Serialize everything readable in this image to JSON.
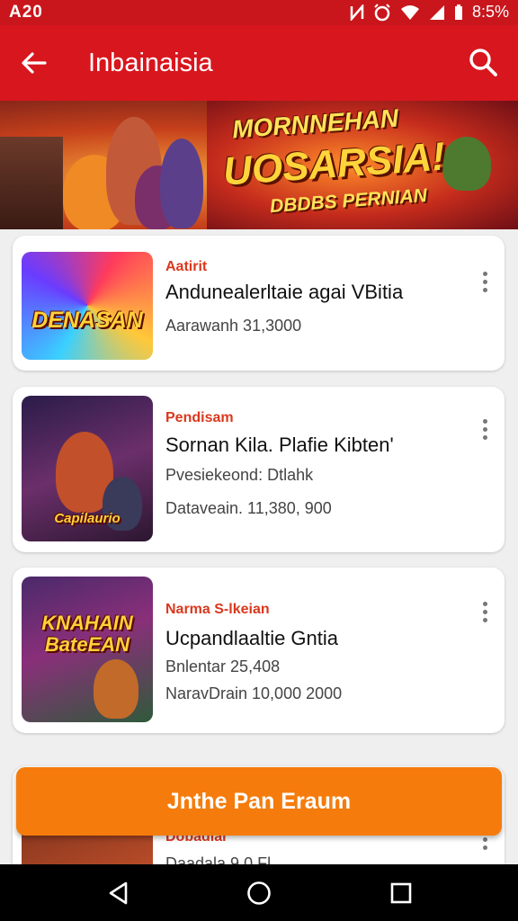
{
  "status_bar": {
    "time": "A20",
    "battery": "8:5%"
  },
  "app_bar": {
    "title": "Inbainaisia"
  },
  "banner": {
    "line1": "MORNNEHAN",
    "line2": "UOSARSIA!",
    "line3": "DBDBS PERNIAN"
  },
  "cards": [
    {
      "thumb_text": "DENASAN",
      "category": "Aatirit",
      "name": "Andunealerltaie agai VBitia",
      "detail": "",
      "meta": "Aarawanh  31,3000"
    },
    {
      "thumb_text": "Capilaurio",
      "category": "Pendisam",
      "name": "Sornan Kila. Plafie Kibten'",
      "detail": "Pvesiekeond: Dtlahk",
      "meta": "Dataveain. 11,380, 900"
    },
    {
      "thumb_text": "KNAHAIN BateEAN",
      "category": "Narma S-lkeian",
      "name": "Ucpandlaaltie Gntia",
      "detail": "Bnlentar  25,408",
      "meta": "NaravDrain 10,000 2000"
    },
    {
      "thumb_text": "",
      "category": "Dobadial",
      "name": "",
      "detail": "",
      "meta": "Daadala  9  0  Fl"
    }
  ],
  "cta": {
    "label": "Jnthe Pan Eraum"
  },
  "colors": {
    "primary": "#d8161e",
    "status": "#c8161c",
    "accent": "#f57c0c",
    "category": "#d9381e"
  }
}
